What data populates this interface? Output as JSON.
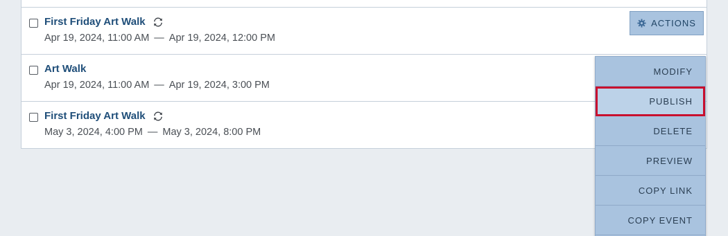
{
  "events": [
    {
      "title": "First Friday Art Walk",
      "recurring": true,
      "start": "Apr 19, 2024, 11:00 AM",
      "separator": "—",
      "end": "Apr 19, 2024, 12:00 PM"
    },
    {
      "title": "Art Walk",
      "recurring": false,
      "start": "Apr 19, 2024, 11:00 AM",
      "separator": "—",
      "end": "Apr 19, 2024, 3:00 PM"
    },
    {
      "title": "First Friday Art Walk",
      "recurring": true,
      "start": "May 3, 2024, 4:00 PM",
      "separator": "—",
      "end": "May 3, 2024, 8:00 PM"
    }
  ],
  "actions_button": {
    "label": "ACTIONS",
    "icon": "gear-icon"
  },
  "actions_menu": {
    "items": [
      "MODIFY",
      "PUBLISH",
      "DELETE",
      "PREVIEW",
      "COPY LINK",
      "COPY EVENT"
    ],
    "highlighted": "PUBLISH"
  },
  "colors": {
    "title": "#1f4e79",
    "menu_bg": "#a9c3df",
    "highlight_border": "#c8102e",
    "page_bg": "#e9edf1"
  }
}
